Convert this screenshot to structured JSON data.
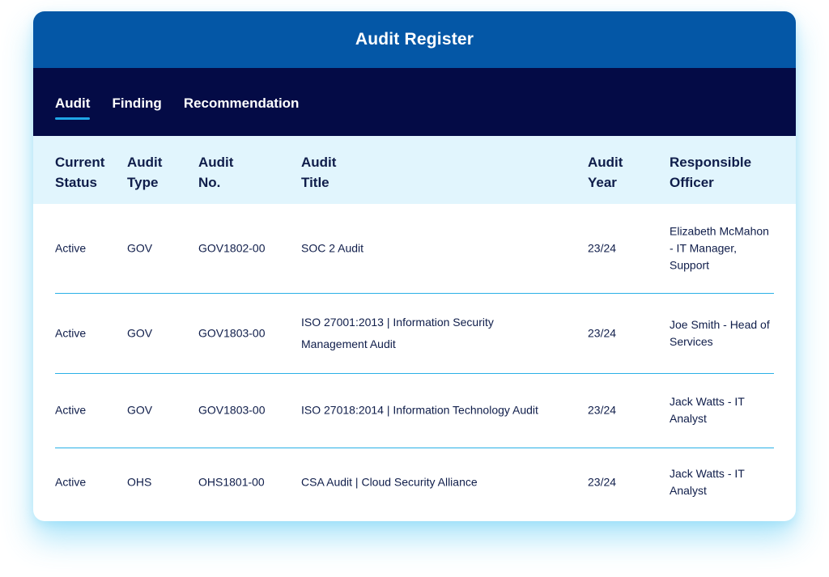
{
  "header": {
    "title": "Audit Register"
  },
  "tabs": [
    {
      "label": "Audit",
      "active": true
    },
    {
      "label": "Finding",
      "active": false
    },
    {
      "label": "Recommendation",
      "active": false
    }
  ],
  "columns": [
    {
      "line1": "Current",
      "line2": "Status"
    },
    {
      "line1": "Audit",
      "line2": "Type"
    },
    {
      "line1": "Audit",
      "line2": "No."
    },
    {
      "line1": "Audit",
      "line2": "Title"
    },
    {
      "line1": "Audit",
      "line2": "Year"
    },
    {
      "line1": "Responsible",
      "line2": "Officer"
    }
  ],
  "rows": [
    {
      "status": "Active",
      "type": "GOV",
      "no": "GOV1802-00",
      "title": "SOC 2 Audit",
      "year": "23/24",
      "officer": "Elizabeth McMahon - IT Manager, Support"
    },
    {
      "status": "Active",
      "type": "GOV",
      "no": "GOV1803-00",
      "title": "ISO 27001:2013 | Information Security Management Audit",
      "year": "23/24",
      "officer": "Joe Smith - Head of Services"
    },
    {
      "status": "Active",
      "type": "GOV",
      "no": "GOV1803-00",
      "title": "ISO 27018:2014 | Information Technology Audit",
      "year": "23/24",
      "officer": "Jack Watts - IT Analyst"
    },
    {
      "status": "Active",
      "type": "OHS",
      "no": "OHS1801-00",
      "title": "CSA Audit | Cloud Security Alliance",
      "year": "23/24",
      "officer": "Jack Watts - IT Analyst"
    }
  ],
  "colors": {
    "title_bar": "#0457a6",
    "tab_bar": "#040b46",
    "header_row": "#e1f5fd",
    "divider": "#2ab0e6",
    "text": "#0f1d4a"
  }
}
